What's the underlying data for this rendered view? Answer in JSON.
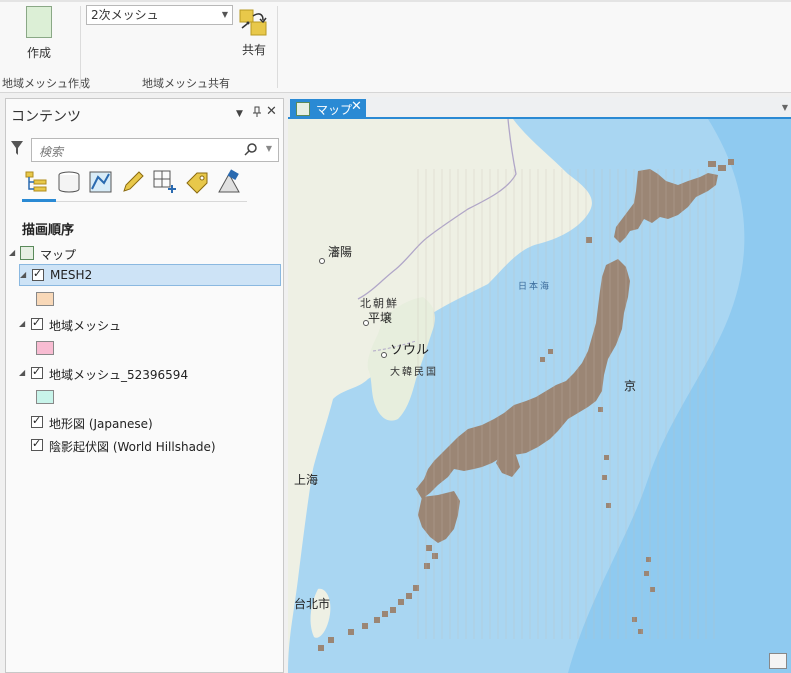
{
  "ribbon": {
    "create_label": "作成",
    "mesh_select_value": "2次メッシュ",
    "share_label": "共有",
    "group_create_label": "地域メッシュ作成",
    "group_share_label": "地域メッシュ共有"
  },
  "contents": {
    "title": "コンテンツ",
    "search_placeholder": "検索",
    "section_title": "描画順序",
    "map_node_label": "マップ",
    "layers": [
      {
        "label": "MESH2",
        "checked": true,
        "selected": true,
        "swatch": "#f8d8b8"
      },
      {
        "label": "地域メッシュ",
        "checked": true,
        "selected": false,
        "swatch": "#f8bcd2"
      },
      {
        "label": "地域メッシュ_52396594",
        "checked": true,
        "selected": false,
        "swatch": "#c8f4ea"
      },
      {
        "label": "地形図 (Japanese)",
        "checked": true,
        "selected": false
      },
      {
        "label": "陰影起伏図 (World Hillshade)",
        "checked": true,
        "selected": false
      }
    ]
  },
  "map": {
    "tab_label": "マップ",
    "labels": {
      "shenyang": "瀋陽",
      "north_korea": "北朝鮮",
      "pyongyang": "平壌",
      "seoul": "ソウル",
      "south_korea": "大韓民国",
      "sea_of_japan": "日本海",
      "shanghai": "上海",
      "taipei": "台北市",
      "tokyo_partial": "京"
    }
  },
  "colors": {
    "accent": "#2a8ad4",
    "ocean": "#a9d6f2",
    "land": "#eef0e4",
    "mesh": "#9b8675"
  }
}
